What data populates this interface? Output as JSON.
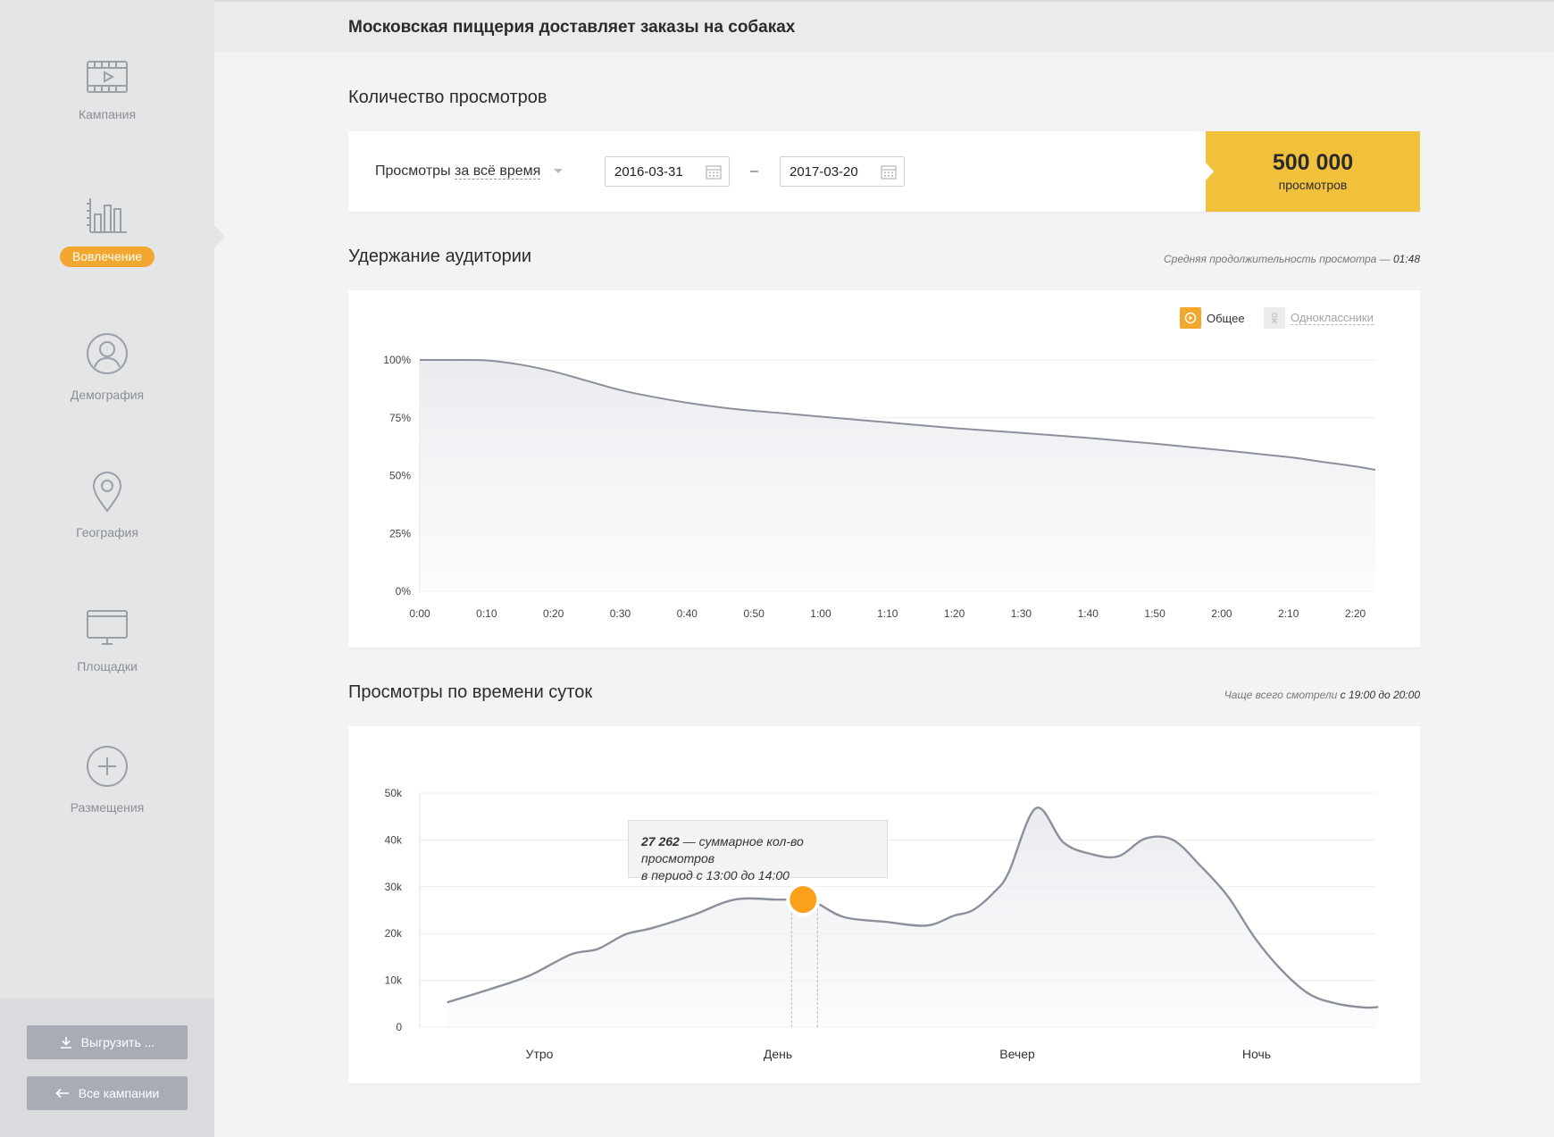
{
  "header": {
    "title": "Московская пиццерия доставляет заказы на собаках"
  },
  "sidebar": {
    "items": [
      {
        "label": "Кампания",
        "icon": "film-play-icon"
      },
      {
        "label": "Вовлечение",
        "icon": "bar-chart-icon",
        "active": true
      },
      {
        "label": "Демография",
        "icon": "user-circle-icon"
      },
      {
        "label": "География",
        "icon": "map-pin-icon"
      },
      {
        "label": "Площадки",
        "icon": "monitor-icon"
      },
      {
        "label": "Размещения",
        "icon": "plus-circle-icon"
      }
    ],
    "export_label": "Выгрузить ...",
    "all_campaigns_label": "Все кампании"
  },
  "views": {
    "title": "Количество просмотров",
    "period_prefix": "Просмотры",
    "period_value": "за всё время",
    "date_from": "2016-03-31",
    "date_sep": "–",
    "date_to": "2017-03-20",
    "total_value": "500 000",
    "total_label": "просмотров",
    "accent_color": "#f2c13c"
  },
  "retention": {
    "title": "Удержание аудитории",
    "note_prefix": "Средняя продолжительность просмотра —",
    "note_value": "01:48",
    "legend": [
      {
        "label": "Общее",
        "active": true,
        "icon": "play-circle-icon"
      },
      {
        "label": "Одноклассники",
        "active": false,
        "icon": "ok-icon"
      }
    ]
  },
  "daytime": {
    "title": "Просмотры по времени суток",
    "note_prefix": "Чаще всего смотрели",
    "note_value": "с 19:00 до 20:00",
    "tooltip_value": "27 262",
    "tooltip_text": "— суммарное кол-во просмотров",
    "tooltip_line2": "в период с 13:00 до 14:00"
  },
  "chart_data": [
    {
      "type": "area",
      "ylim": [
        0,
        100
      ],
      "y_ticks": [
        "0%",
        "25%",
        "50%",
        "75%",
        "100%"
      ],
      "y_tick_values": [
        0,
        25,
        50,
        75,
        100
      ],
      "x_ticks": [
        "0:00",
        "0:10",
        "0:20",
        "0:30",
        "0:40",
        "0:50",
        "1:00",
        "1:10",
        "1:20",
        "1:30",
        "1:40",
        "1:50",
        "2:00",
        "2:10",
        "2:20"
      ],
      "xlim": [
        0,
        143
      ],
      "grid": true,
      "series": [
        {
          "name": "Общее",
          "x": [
            0,
            5,
            10,
            15,
            20,
            25,
            30,
            35,
            40,
            45,
            50,
            55,
            60,
            70,
            80,
            90,
            100,
            110,
            120,
            130,
            135,
            140,
            143
          ],
          "values": [
            100,
            100,
            99.8,
            98,
            95,
            91,
            87,
            84,
            81.5,
            79.5,
            78,
            76.8,
            75.5,
            73,
            70.5,
            68.5,
            66.3,
            63.8,
            61,
            58,
            56,
            54,
            52.5
          ]
        }
      ]
    },
    {
      "type": "area",
      "ylim": [
        0,
        50000
      ],
      "y_ticks": [
        "0",
        "10k",
        "20k",
        "30k",
        "40k",
        "50k"
      ],
      "y_tick_values": [
        0,
        10000,
        20000,
        30000,
        40000,
        50000
      ],
      "categories": [
        "Утро",
        "День",
        "Вечер",
        "Ночь"
      ],
      "xlim": [
        0,
        24
      ],
      "grid": true,
      "highlight": {
        "x": 14.0,
        "value": 27262
      },
      "series": [
        {
          "x": [
            1.0,
            2.5,
            4.0,
            5.5,
            6.5,
            7.5,
            8.5,
            10.0,
            11.5,
            13.0,
            13.6,
            14.0,
            14.5,
            15.5,
            17.0,
            18.5,
            19.5,
            20.2,
            21.0,
            21.5,
            22.5,
            23.5,
            24.5,
            25.5,
            26.5,
            27.5,
            28.5,
            29.5,
            30.5,
            31.5,
            32.5,
            33.5,
            34.5,
            35.0
          ],
          "values": [
            5300,
            8000,
            11000,
            15500,
            16700,
            19800,
            21200,
            24000,
            27262,
            27262,
            27262,
            27262,
            26500,
            23500,
            22500,
            21700,
            23800,
            25000,
            29000,
            33000,
            46800,
            39500,
            37000,
            36500,
            40300,
            40000,
            34500,
            28000,
            19000,
            12000,
            7000,
            5000,
            4200,
            4300
          ]
        }
      ]
    }
  ]
}
